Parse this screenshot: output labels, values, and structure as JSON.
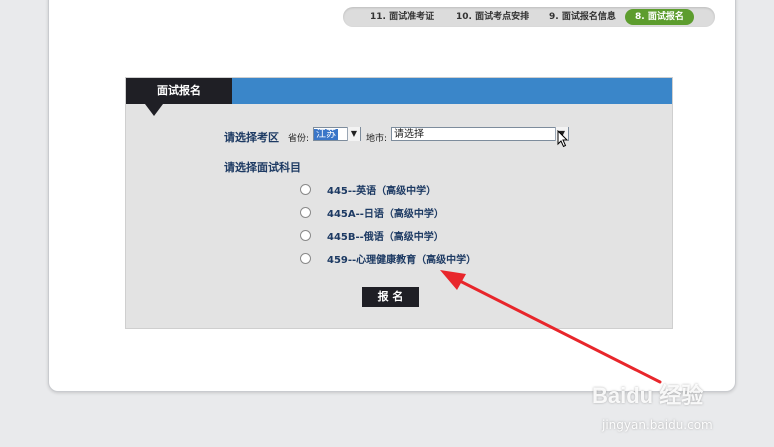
{
  "steps": [
    {
      "label": "11. 面试准考证",
      "active": false
    },
    {
      "label": "10. 面试考点安排",
      "active": false
    },
    {
      "label": "9. 面试报名信息",
      "active": false
    },
    {
      "label": "8. 面试报名",
      "active": true
    }
  ],
  "panel": {
    "tab_title": "面试报名",
    "area_label": "请选择考区",
    "province_label": "省份:",
    "province_value": "江苏",
    "city_label": "地市:",
    "city_value": "请选择",
    "subject_label": "请选择面试科目",
    "subjects": [
      "445--英语（高级中学）",
      "445A--日语（高级中学）",
      "445B--俄语（高级中学）",
      "459--心理健康教育（高级中学）"
    ],
    "submit_label": "报 名"
  },
  "watermark": {
    "logo": "Baidu 经验",
    "url": "jingyan.baidu.com"
  },
  "colors": {
    "header_blue": "#3a86c9",
    "dark": "#1f1f25",
    "active_step": "#5d9d2e",
    "annotation": "#e8262b"
  },
  "icons": {
    "dropdown": "chevron-down-icon",
    "cursor": "mouse-pointer-icon",
    "annotation": "red-arrow-icon"
  }
}
